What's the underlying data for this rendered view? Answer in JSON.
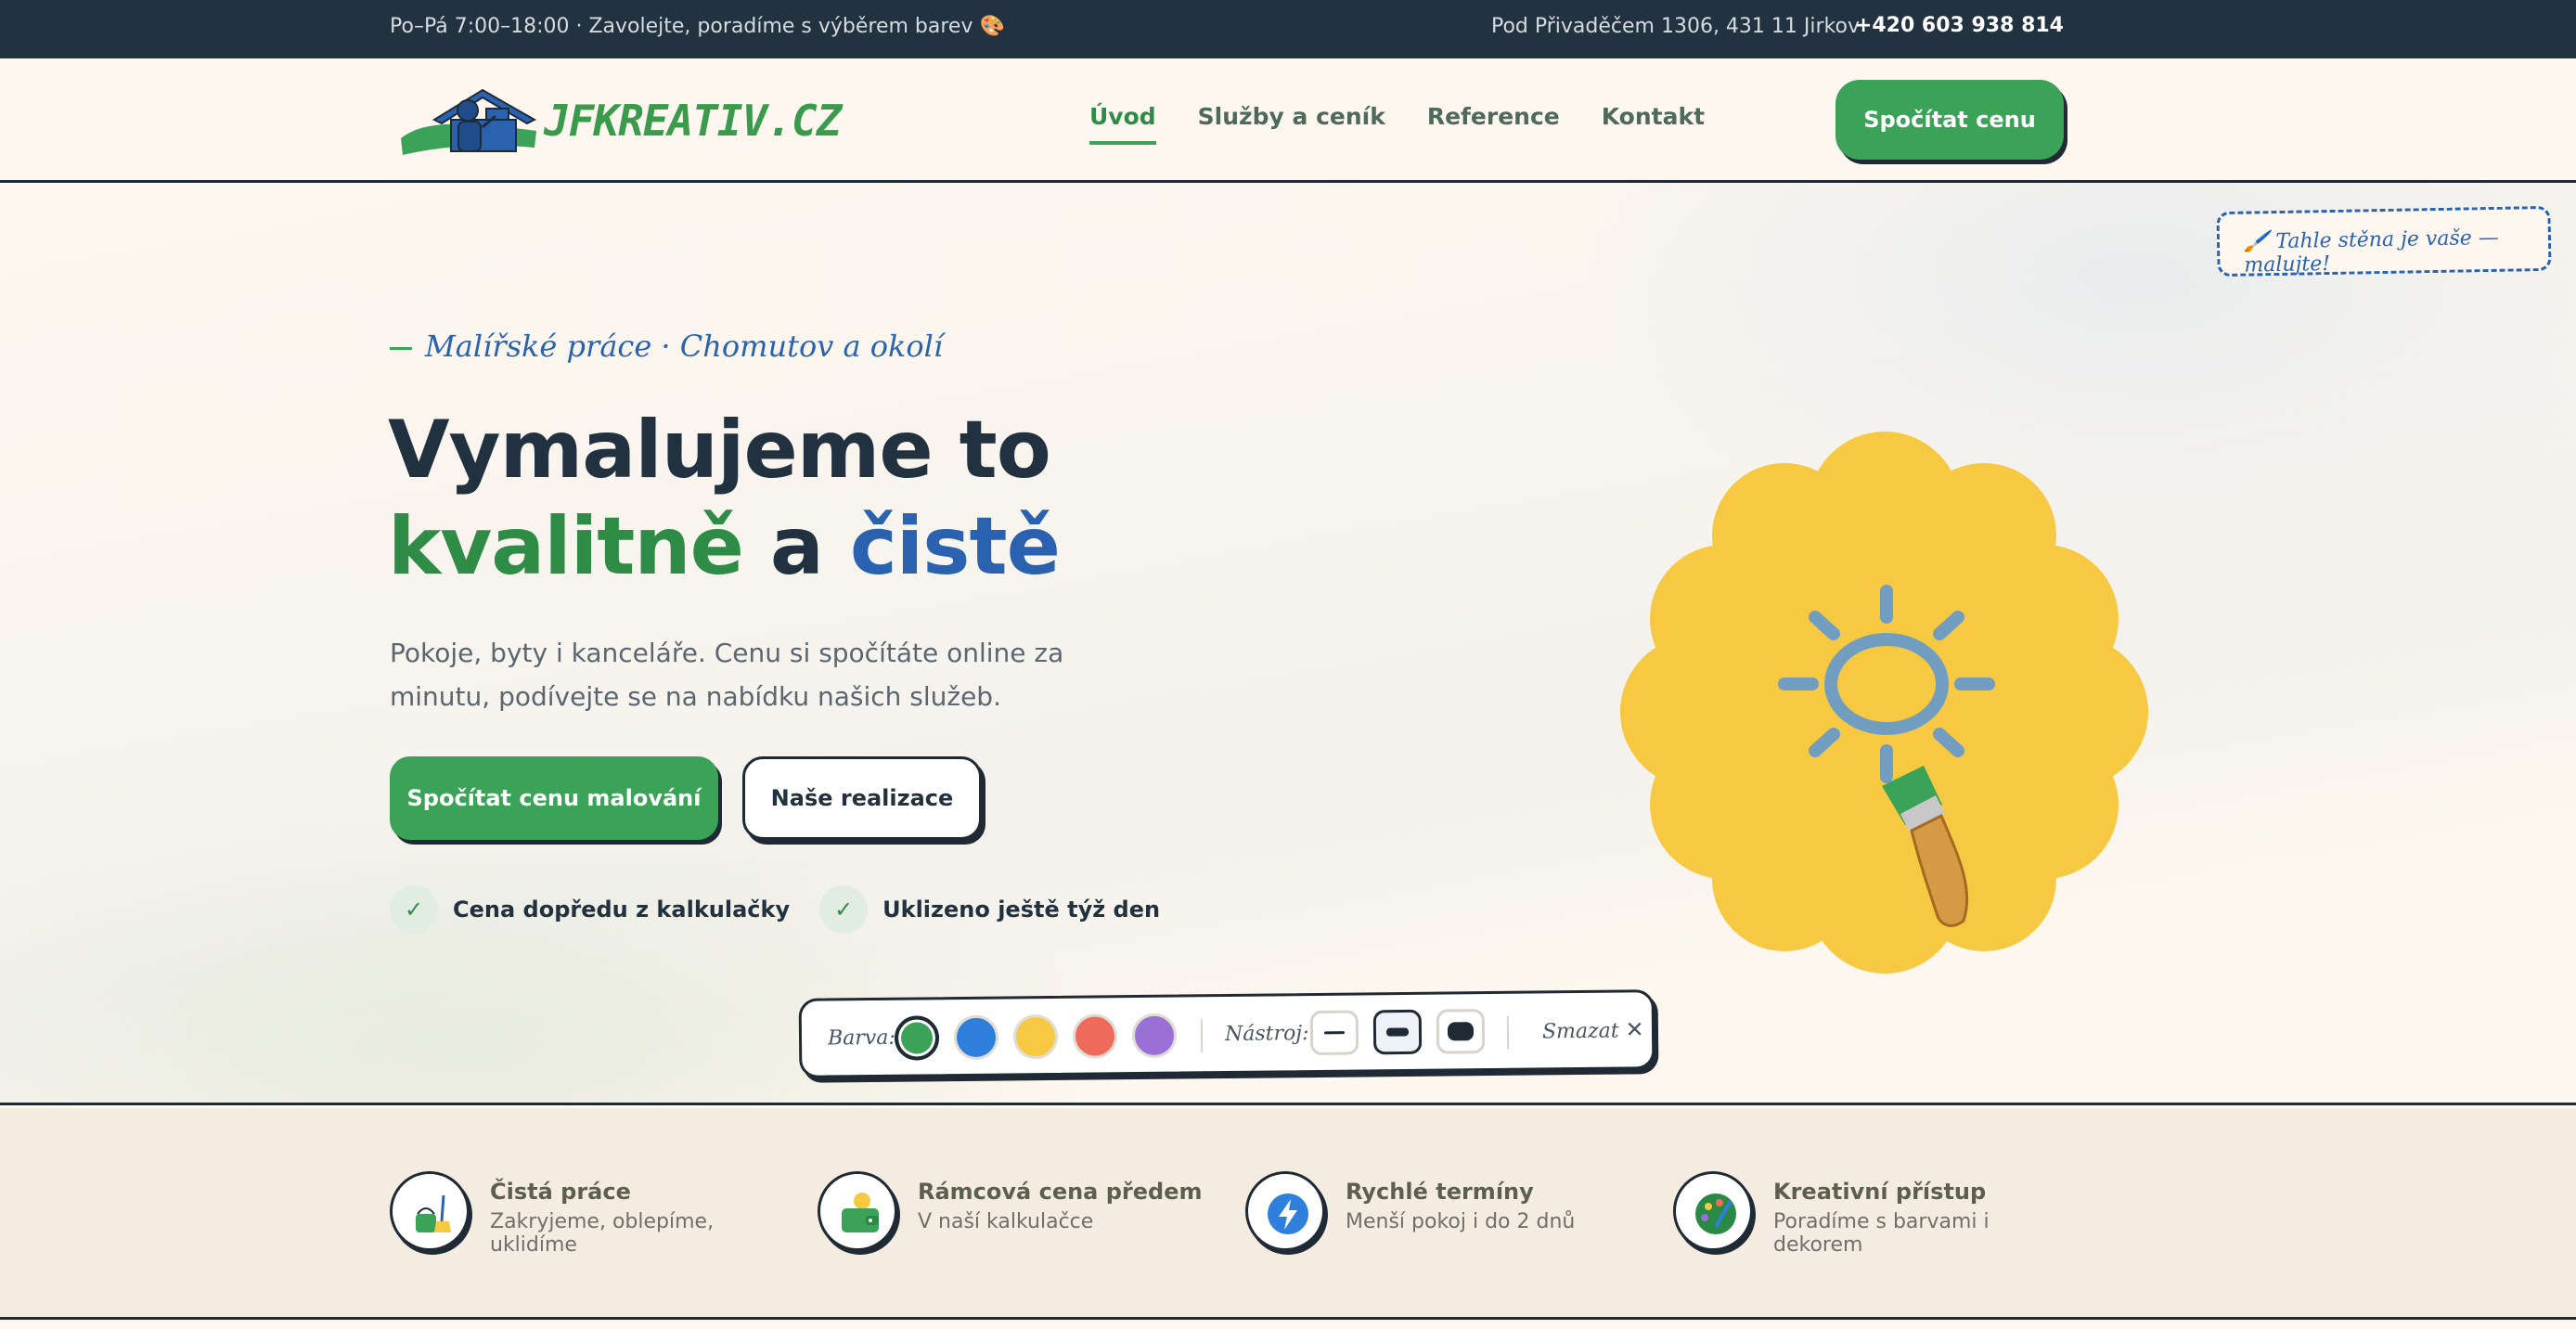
{
  "topbar": {
    "hours": "Po–Pá 7:00–18:00 · Zavolejte, poradíme s výběrem barev 🎨",
    "address": "Pod Přivaděčem 1306, 431 11 Jirkov",
    "phone": "+420 603 938 814"
  },
  "header": {
    "logo_text": "JFKREATIV.CZ",
    "nav": [
      {
        "label": "Úvod",
        "active": true
      },
      {
        "label": "Služby a ceník",
        "active": false
      },
      {
        "label": "Reference",
        "active": false
      },
      {
        "label": "Kontakt",
        "active": false
      }
    ],
    "cta_label": "Spočítat cenu"
  },
  "hero": {
    "wall_note": "🖌️ Tahle stěna je vaše — malujte!",
    "eyebrow": "Malířské práce · Chomutov a okolí",
    "title_line1": "Vymalujeme to",
    "title_green": "kvalitně",
    "title_and": " a ",
    "title_blue": "čistě",
    "lead": "Pokoje, byty i kanceláře. Cenu si spočítáte online za minutu, podívejte se na nabídku našich služeb.",
    "btn_primary": "Spočítat cenu malování",
    "btn_secondary": "Naše realizace",
    "checks": [
      {
        "mark": "✓",
        "label": "Cena dopředu z kalkulačky"
      },
      {
        "mark": "✓",
        "label": "Uklizeno ještě týž den"
      }
    ]
  },
  "toolbar": {
    "color_label": "Barva:",
    "colors": [
      "#3aa357",
      "#2f80dd",
      "#f7c942",
      "#ee6b5b",
      "#9a6fd6"
    ],
    "selected_color": 0,
    "tool_label": "Nástroj:",
    "selected_tool": 1,
    "clear_label": "Smazat",
    "clear_icon": "✕"
  },
  "features": [
    {
      "icon": "bucket-broom-icon",
      "title": "Čistá práce",
      "subtitle": "Zakryjeme, oblepíme, uklidíme"
    },
    {
      "icon": "wallet-icon",
      "title": "Rámcová cena předem",
      "subtitle": "V naší kalkulačce"
    },
    {
      "icon": "lightning-icon",
      "title": "Rychlé termíny",
      "subtitle": "Menší pokoj i do 2 dnů"
    },
    {
      "icon": "palette-icon",
      "title": "Kreativní přístup",
      "subtitle": "Poradíme s barvami i dekorem"
    }
  ]
}
